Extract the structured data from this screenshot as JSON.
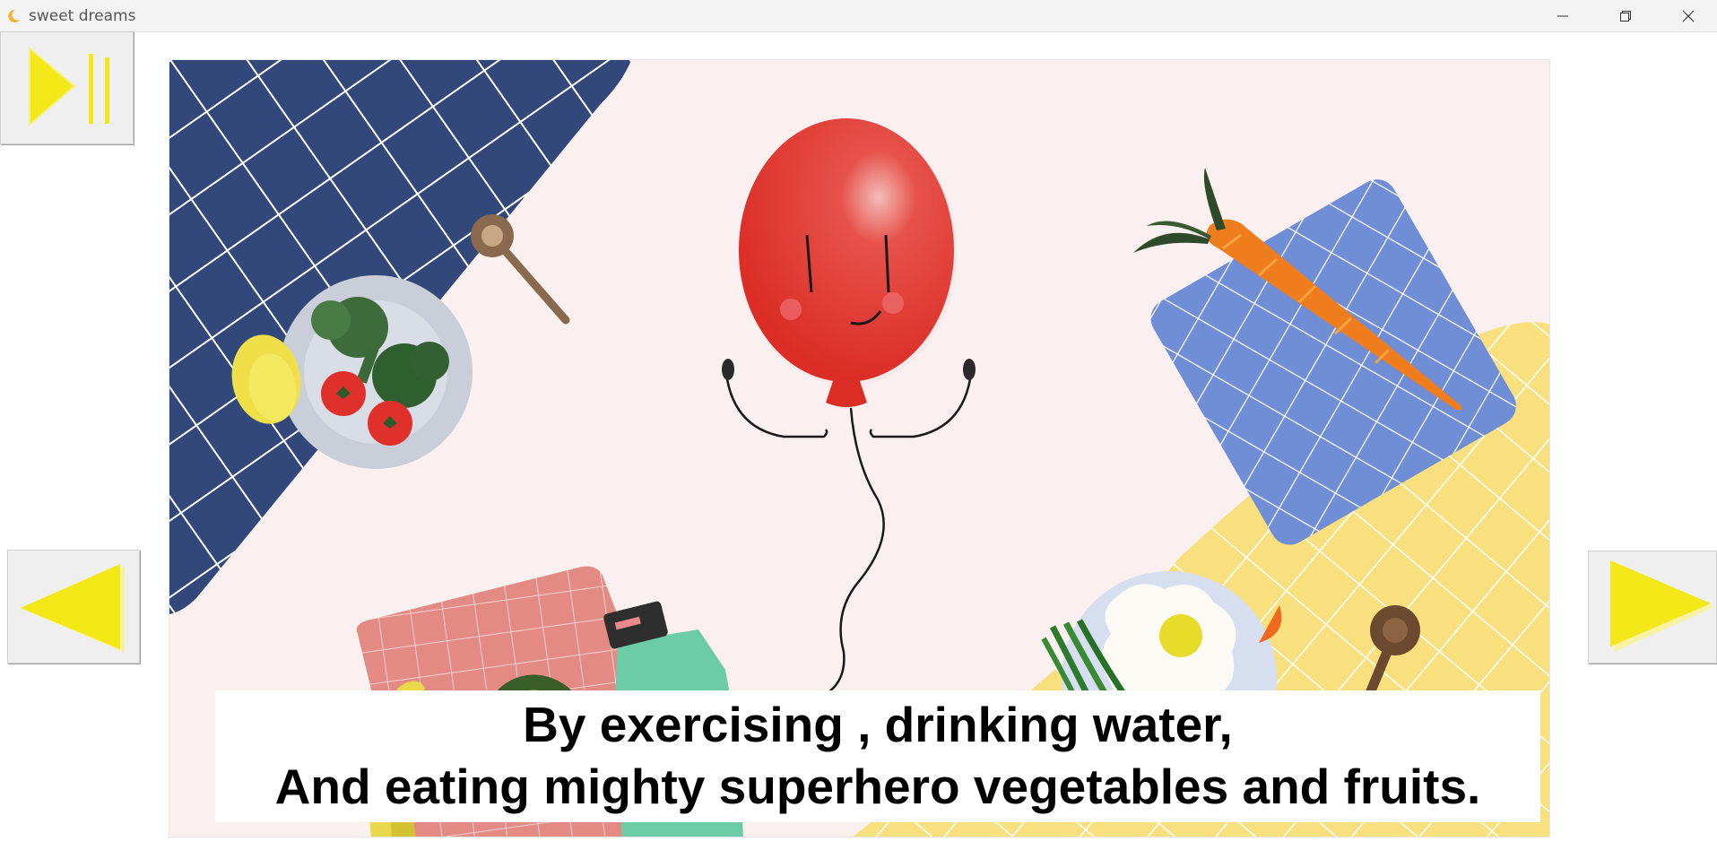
{
  "window": {
    "title": "sweet dreams",
    "icon": "crescent-moon-icon"
  },
  "controls": {
    "play_pause_icon": "play-pause-icon",
    "prev_icon": "previous-arrow-icon",
    "next_icon": "next-arrow-icon",
    "accent_color": "#f3e818"
  },
  "caption": {
    "line1": "By exercising , drinking water,",
    "line2": "And eating mighty superhero vegetables and fruits."
  },
  "colors": {
    "scene_background": "#fbf0f0",
    "navy_tablecloth": "#33487a",
    "blue_napkin": "#6f8ed6",
    "yellow_tablecloth": "#f9e07f",
    "pink_napkin": "#e48a84",
    "balloon": "#e0302c"
  }
}
